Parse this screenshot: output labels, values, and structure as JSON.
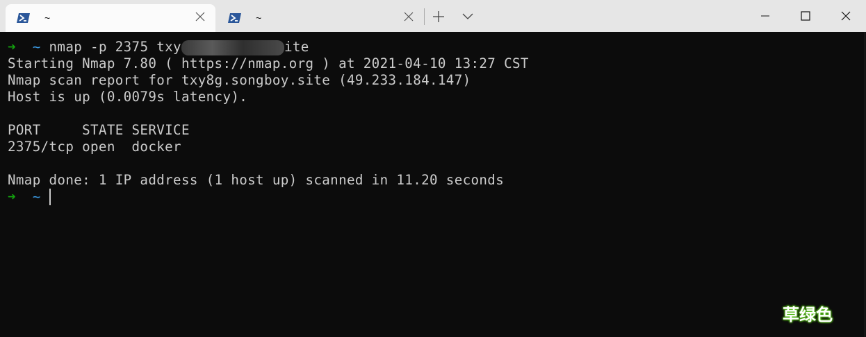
{
  "tabs": [
    {
      "title": "~",
      "icon": "powershell-icon",
      "active": true
    },
    {
      "title": "~",
      "icon": "powershell-icon",
      "active": false
    }
  ],
  "colors": {
    "prompt_arrow": "#13a10e",
    "prompt_tilde": "#3a96dd",
    "text": "#cccccc",
    "background": "#0c0c0c"
  },
  "terminal": {
    "prompt_arrow": "➜",
    "prompt_dir": "~",
    "command_start": "nmap -p 2375 txy",
    "command_end": "ite",
    "lines": [
      "Starting Nmap 7.80 ( https://nmap.org ) at 2021-04-10 13:27 CST",
      "Nmap scan report for txy8g.songboy.site (49.233.184.147)",
      "Host is up (0.0079s latency).",
      "",
      "PORT     STATE SERVICE",
      "2375/tcp open  docker",
      "",
      "Nmap done: 1 IP address (1 host up) scanned in 11.20 seconds"
    ]
  },
  "watermark": "草绿色"
}
